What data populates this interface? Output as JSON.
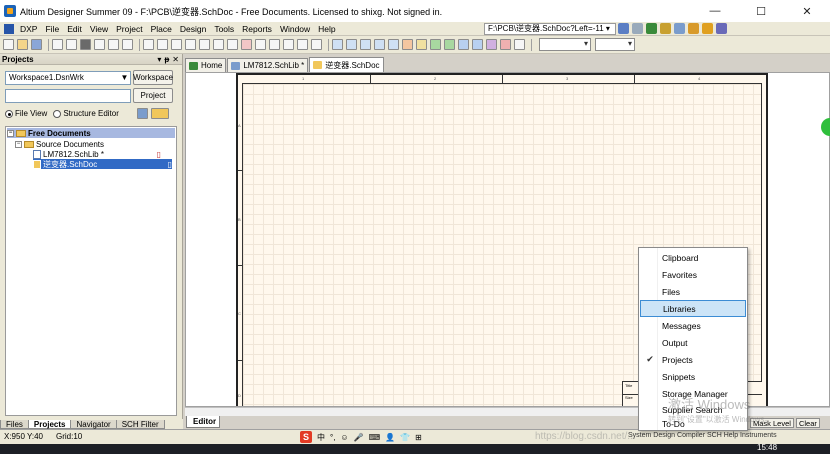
{
  "window": {
    "title": "Altium Designer Summer 09 - F:\\PCB\\逆变器.SchDoc - Free Documents. Licensed to shixg. Not signed in.",
    "minimize": "—",
    "maximize": "☐",
    "close": "✕"
  },
  "menubar": {
    "items": [
      {
        "label": "DXP"
      },
      {
        "label": "File"
      },
      {
        "label": "Edit"
      },
      {
        "label": "View"
      },
      {
        "label": "Project"
      },
      {
        "label": "Place"
      },
      {
        "label": "Design"
      },
      {
        "label": "Tools"
      },
      {
        "label": "Reports"
      },
      {
        "label": "Window"
      },
      {
        "label": "Help"
      }
    ],
    "path_value": "F:\\PCB\\逆变器.SchDoc?Left=-11 ▾"
  },
  "projects_panel": {
    "title": "Projects",
    "controls": [
      "▾",
      "ᵽ",
      "✕"
    ],
    "workspace_value": "Workspace1.DsnWrk",
    "workspace_button": "Workspace",
    "project_button": "Project",
    "file_view_label": "File View",
    "structure_editor_label": "Structure Editor",
    "tree": {
      "root": "Free Documents",
      "folder": "Source Documents",
      "items": [
        {
          "label": "LM7812.SchLib *",
          "selected": false
        },
        {
          "label": "逆变器.SchDoc",
          "selected": true
        }
      ]
    },
    "bottom_tabs": [
      "Files",
      "Projects",
      "Navigator",
      "SCH Filter"
    ]
  },
  "doc_tabs": [
    {
      "label": "Home",
      "icon": "home-icon"
    },
    {
      "label": "LM7812.SchLib *",
      "icon": "schlib-icon"
    },
    {
      "label": "逆变器.SchDoc",
      "icon": "schdoc-icon"
    }
  ],
  "editor": {
    "tab_label": "Editor",
    "zone_numbers": [
      "1",
      "2",
      "3",
      "4"
    ],
    "side_letters": [
      "A",
      "B",
      "C",
      "D"
    ],
    "titleblock": {
      "title_label": "Title",
      "size_label": "Size",
      "number_label": "Number"
    }
  },
  "popup_menu": {
    "items": [
      {
        "label": "Clipboard",
        "checked": false,
        "highlighted": false
      },
      {
        "label": "Favorites",
        "checked": false,
        "highlighted": false
      },
      {
        "label": "Files",
        "checked": false,
        "highlighted": false
      },
      {
        "label": "Libraries",
        "checked": false,
        "highlighted": true
      },
      {
        "label": "Messages",
        "checked": false,
        "highlighted": false
      },
      {
        "label": "Output",
        "checked": false,
        "highlighted": false
      },
      {
        "label": "Projects",
        "checked": true,
        "highlighted": false
      },
      {
        "label": "Snippets",
        "checked": false,
        "highlighted": false
      },
      {
        "label": "Storage Manager",
        "checked": false,
        "highlighted": false
      },
      {
        "label": "Supplier Search",
        "checked": false,
        "highlighted": false
      },
      {
        "label": "To-Do",
        "checked": false,
        "highlighted": false
      }
    ],
    "checkmark": "✔"
  },
  "status": {
    "coords": "X:950 Y:40",
    "grid": "Grid:10",
    "mask_level": "Mask Level",
    "clear": "Clear",
    "system_text": "System  Design Compiler  SCH  Help  Instruments"
  },
  "ime": {
    "logo": "S",
    "items": [
      "中",
      "°,",
      "☺",
      "🎤",
      "⌨",
      "👤",
      "👕",
      "⊞"
    ]
  },
  "watermarks": {
    "url": "https://blog.csdn.net/...",
    "windows_line1": "激活 Windows",
    "windows_line2": "转到\"设置\"以激活 Windows。"
  },
  "taskbar": {
    "clock": "15:48"
  },
  "colors": {
    "selection": "#316ac5",
    "menu_highlight": "#cce4f7",
    "sheet_bg": "#fff8ed"
  }
}
